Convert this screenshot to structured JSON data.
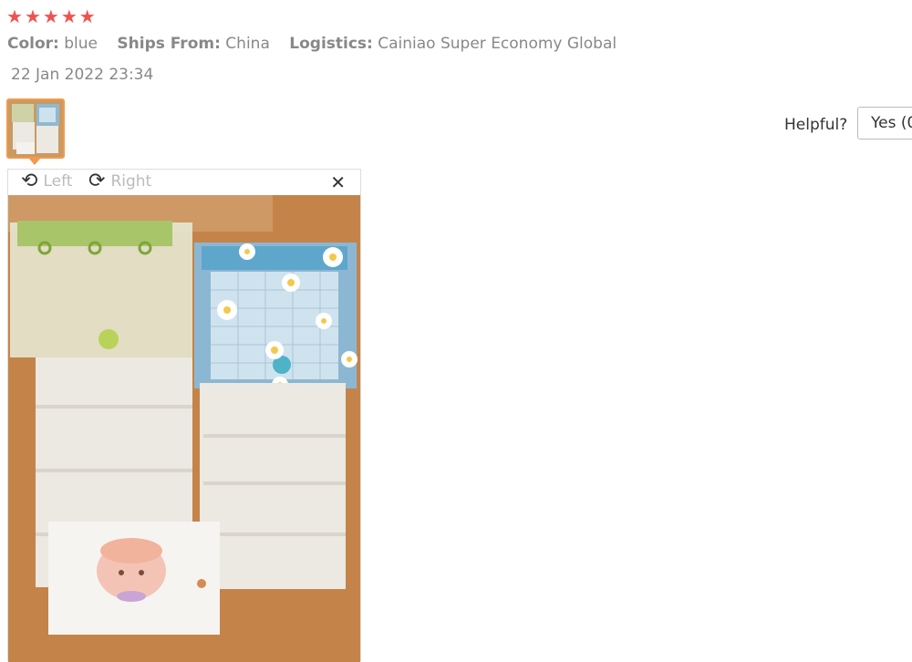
{
  "review": {
    "rating": 5,
    "color_label": "Color:",
    "color_value": "blue",
    "ships_label": "Ships From:",
    "ships_value": "China",
    "logistics_label": "Logistics:",
    "logistics_value": "Cainiao Super Economy Global",
    "date": "22 Jan 2022 23:34"
  },
  "helpful": {
    "label": "Helpful?",
    "yes_label": "Yes (0"
  },
  "viewer": {
    "rotate_left": "Left",
    "rotate_right": "Right",
    "close_glyph": "✕"
  },
  "icons": {
    "star": "★",
    "rotate_left": "⟲",
    "rotate_right": "⟳"
  },
  "colors": {
    "star": "#ef5350",
    "thumb_border": "#f19a4a",
    "muted_text": "#888888"
  }
}
